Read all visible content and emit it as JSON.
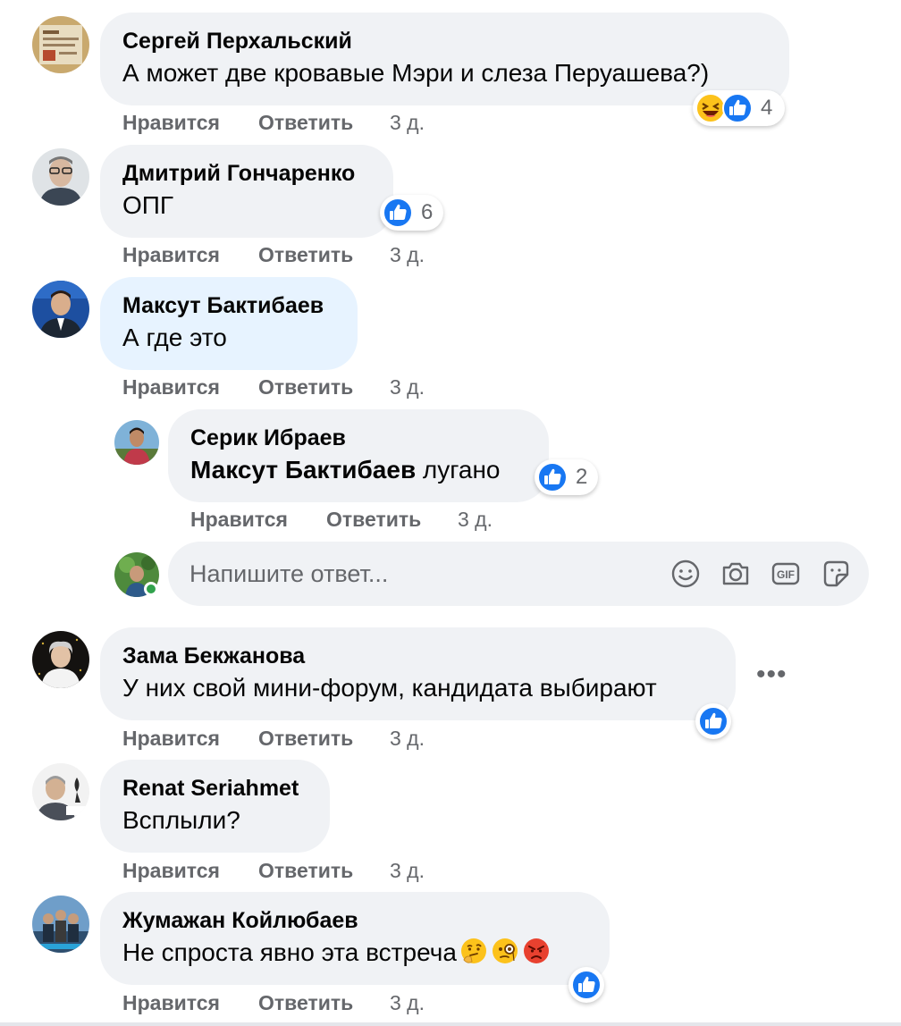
{
  "comments": [
    {
      "author": "Сергей Перхальский",
      "text": "А может две кровавые Мэри и слеза Перуашева?)",
      "like_label": "Нравится",
      "reply_label": "Ответить",
      "time": "3 д.",
      "reactions": [
        "laugh",
        "like"
      ],
      "reaction_count": "4"
    },
    {
      "author": "Дмитрий Гончаренко",
      "text": "ОПГ",
      "like_label": "Нравится",
      "reply_label": "Ответить",
      "time": "3 д.",
      "reactions": [
        "like"
      ],
      "reaction_count": "6"
    },
    {
      "author": "Максут Бактибаев",
      "text": "А где это",
      "like_label": "Нравится",
      "reply_label": "Ответить",
      "time": "3 д.",
      "highlighted": true,
      "replies": [
        {
          "author": "Серик Ибраев",
          "mention": "Максут Бактибаев",
          "text": " лугано",
          "like_label": "Нравится",
          "reply_label": "Ответить",
          "time": "3 д.",
          "reactions": [
            "like"
          ],
          "reaction_count": "2"
        }
      ]
    },
    {
      "author": "Зама Бекжанова",
      "text": "У них свой мини-форум, кандидата выбирают",
      "like_label": "Нравится",
      "reply_label": "Ответить",
      "time": "3 д.",
      "reactions": [
        "like"
      ],
      "more_label": "•••"
    },
    {
      "author": "Renat Seriahmet",
      "text": "Всплыли?",
      "like_label": "Нравится",
      "reply_label": "Ответить",
      "time": "3 д."
    },
    {
      "author": "Жумажан Койлюбаев",
      "text": "Не спроста явно эта встреча",
      "text_emojis": [
        "thinking-face",
        "face-with-monocle",
        "angry-face"
      ],
      "like_label": "Нравится",
      "reply_label": "Ответить",
      "time": "3 д.",
      "reactions": [
        "like"
      ]
    }
  ],
  "reply_input": {
    "placeholder": "Напишите ответ...",
    "tools": [
      "smiley-icon",
      "camera-icon",
      "gif-icon",
      "sticker-icon"
    ],
    "gif_label": "GIF"
  },
  "colors": {
    "bubble": "#f0f2f5",
    "bubble_highlight": "#e7f3ff",
    "secondary_text": "#65676b",
    "like_blue": "#1877f2",
    "online_green": "#31a24c"
  }
}
